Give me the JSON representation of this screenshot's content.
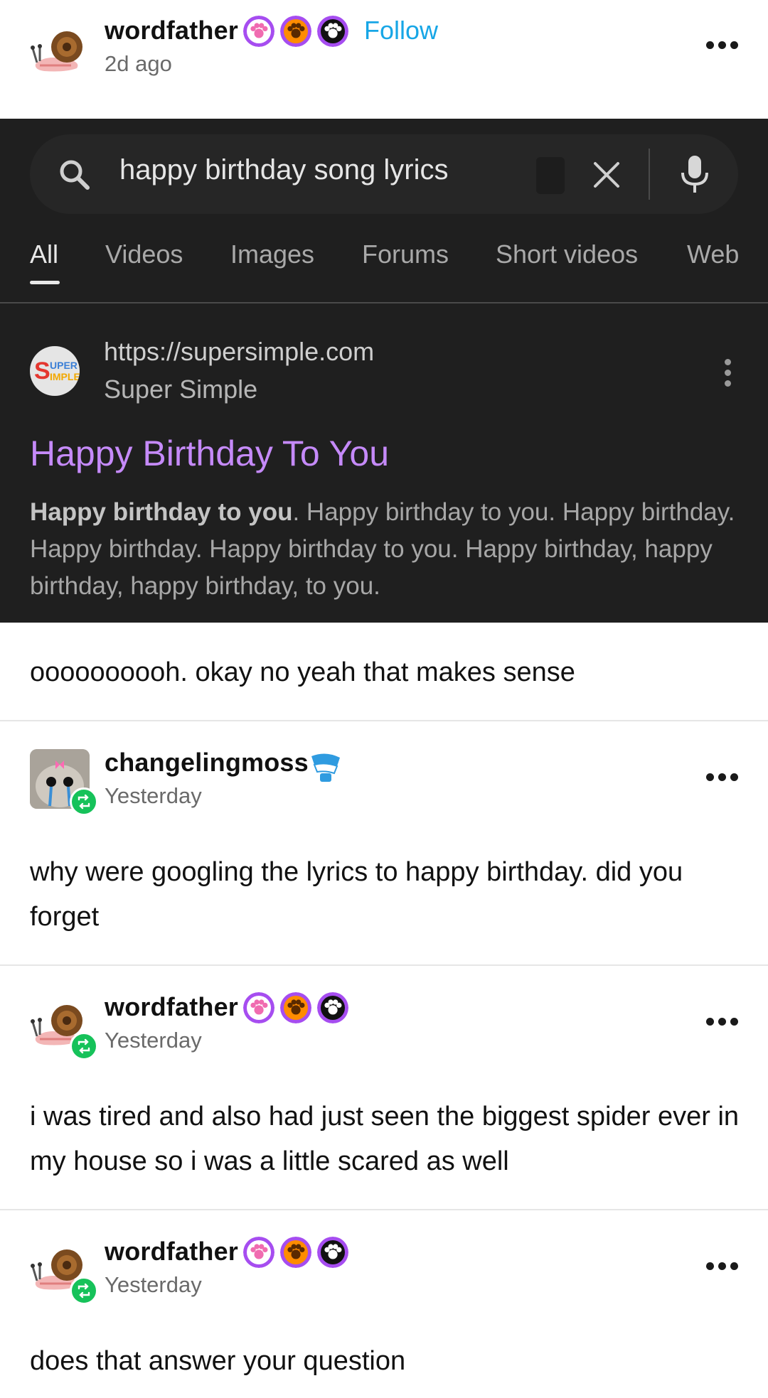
{
  "op": {
    "username": "wordfather",
    "timestamp": "2d ago",
    "follow_label": "Follow",
    "badges": [
      "paw-badge-pink",
      "paw-badge-orange",
      "paw-badge-black"
    ]
  },
  "screenshot": {
    "search_query": "happy birthday song lyrics",
    "tabs": [
      {
        "label": "All",
        "active": true
      },
      {
        "label": "Videos",
        "active": false
      },
      {
        "label": "Images",
        "active": false
      },
      {
        "label": "Forums",
        "active": false
      },
      {
        "label": "Short videos",
        "active": false
      },
      {
        "label": "Web",
        "active": false
      }
    ],
    "result": {
      "url": "https://supersimple.com",
      "site_name": "Super Simple",
      "logo_text": "SUPER SIMPLE",
      "title": "Happy Birthday To You",
      "snippet_bold": "Happy birthday to you",
      "snippet_rest": ". Happy birthday to you. Happy birthday. Happy birthday. Happy birthday to you. Happy birthday, happy birthday, happy birthday, to you."
    },
    "colors": {
      "background": "#1f1f1f",
      "link": "#c58af9"
    }
  },
  "op_caption": "oooooooooh. okay no yeah that makes sense",
  "replies": [
    {
      "username": "changelingmoss",
      "timestamp": "Yesterday",
      "badge": "toy-teeth-badge",
      "text": "why were googling the lyrics to happy birthday. did you forget"
    },
    {
      "username": "wordfather",
      "timestamp": "Yesterday",
      "badges": [
        "paw-badge-pink",
        "paw-badge-orange",
        "paw-badge-black"
      ],
      "text": "i was tired and also had just seen the biggest spider ever in my house so i was a little scared as well"
    },
    {
      "username": "wordfather",
      "timestamp": "Yesterday",
      "badges": [
        "paw-badge-pink",
        "paw-badge-orange",
        "paw-badge-black"
      ],
      "text": "does that answer your question"
    }
  ],
  "colors": {
    "follow": "#17a6e6",
    "reblog": "#16c25a",
    "timestamp": "#6a6a6a"
  }
}
